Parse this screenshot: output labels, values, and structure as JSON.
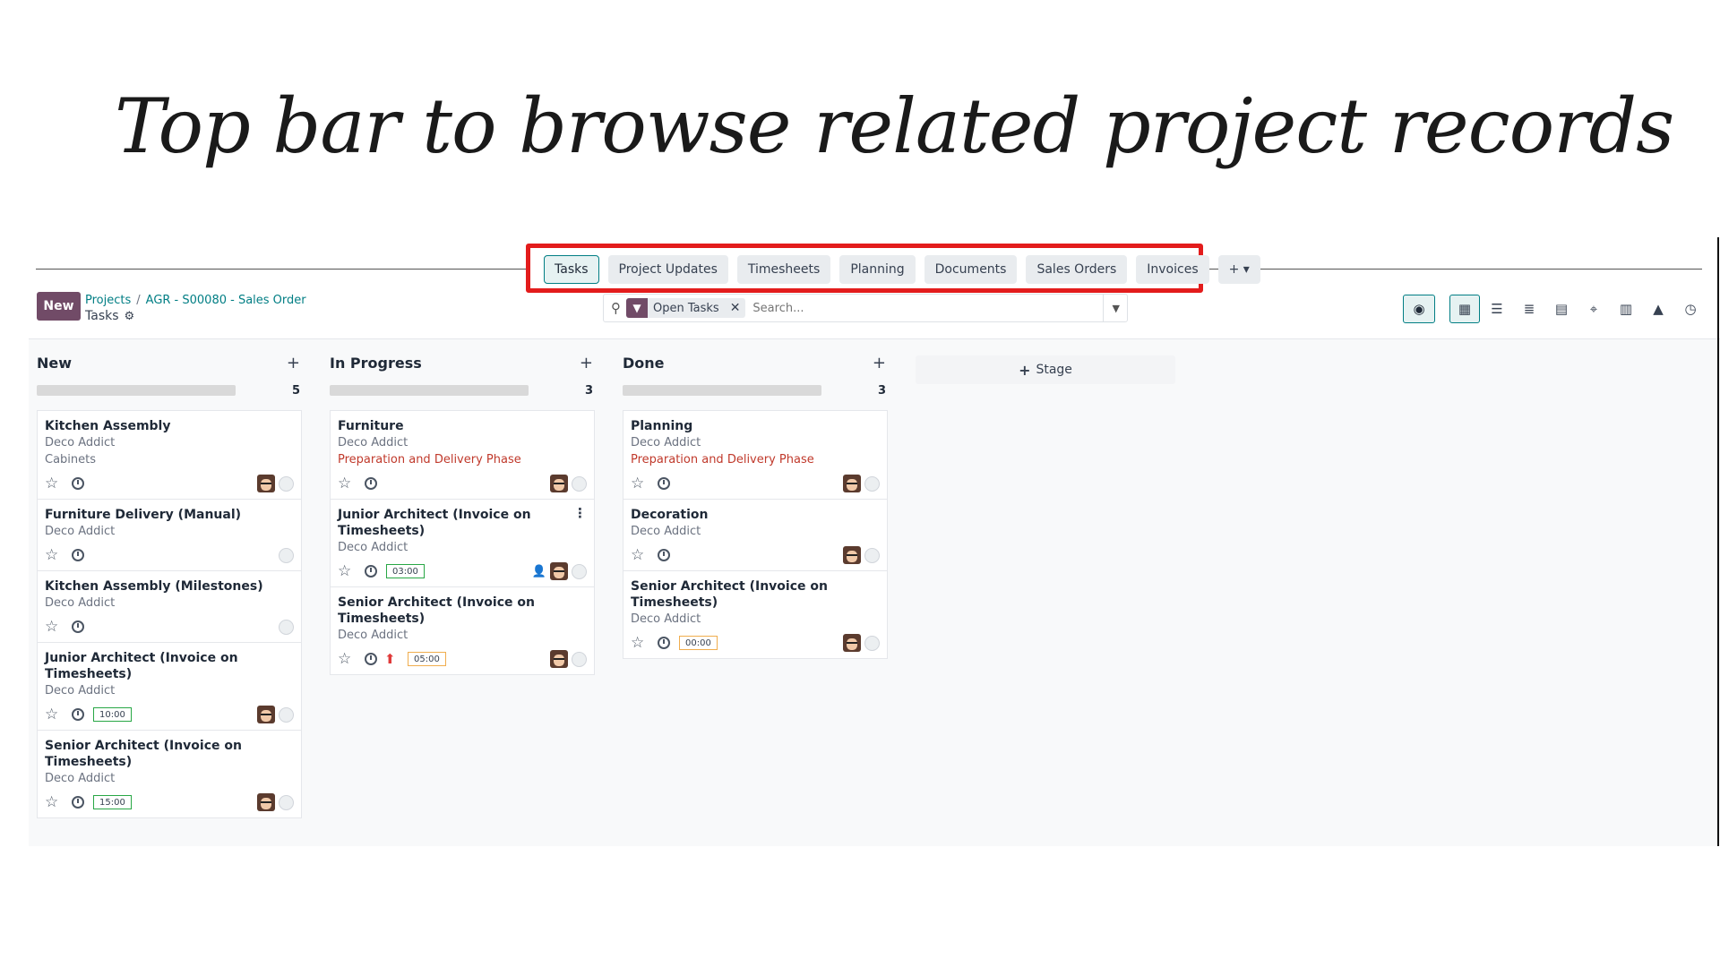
{
  "headline": "Top bar to browse related project records",
  "relations": {
    "tabs": [
      "Tasks",
      "Project Updates",
      "Timesheets",
      "Planning",
      "Documents",
      "Sales Orders",
      "Invoices"
    ],
    "more_label": "+ ▾"
  },
  "control_panel": {
    "new_label": "New",
    "breadcrumb": [
      "Projects",
      "AGR - S00080 - Sales Order"
    ],
    "breadcrumb_sep": "/",
    "subtitle": "Tasks",
    "search": {
      "facet": "Open Tasks",
      "placeholder": "Search..."
    }
  },
  "icons": {
    "search": "search-icon",
    "filter": "filter-icon",
    "eye": "eye-icon",
    "views": [
      "kanban-view-icon",
      "list-view-icon",
      "activity-list-view-icon",
      "calendar-view-icon",
      "map-view-icon",
      "pivot-view-icon",
      "graph-view-icon",
      "activity-view-icon"
    ]
  },
  "colors": {
    "brand": "#714b67",
    "accent": "#017e84",
    "highlight": "#e31c1c",
    "milestone": "#c0392b"
  },
  "columns": [
    {
      "title": "New",
      "count": "5",
      "cards": [
        {
          "title": "Kitchen Assembly",
          "customer": "Deco Addict",
          "tag": "Cabinets",
          "milestone": "",
          "hours": "",
          "avatar": true,
          "menu": false
        },
        {
          "title": "Furniture Delivery (Manual)",
          "customer": "Deco Addict",
          "tag": "",
          "milestone": "",
          "hours": "",
          "avatar": false,
          "menu": false
        },
        {
          "title": "Kitchen Assembly (Milestones)",
          "customer": "Deco Addict",
          "tag": "",
          "milestone": "",
          "hours": "",
          "avatar": false,
          "menu": false
        },
        {
          "title": "Junior Architect (Invoice on Timesheets)",
          "customer": "Deco Addict",
          "tag": "",
          "milestone": "",
          "hours": "10:00",
          "avatar": true,
          "menu": false
        },
        {
          "title": "Senior Architect (Invoice on Timesheets)",
          "customer": "Deco Addict",
          "tag": "",
          "milestone": "",
          "hours": "15:00",
          "avatar": true,
          "menu": false
        }
      ]
    },
    {
      "title": "In Progress",
      "count": "3",
      "cards": [
        {
          "title": "Furniture",
          "customer": "Deco Addict",
          "tag": "",
          "milestone": "Preparation and Delivery Phase",
          "hours": "",
          "avatar": true,
          "menu": false
        },
        {
          "title": "Junior Architect (Invoice on Timesheets)",
          "customer": "Deco Addict",
          "tag": "",
          "milestone": "",
          "hours": "03:00",
          "avatar": true,
          "menu": true,
          "follower": true
        },
        {
          "title": "Senior Architect (Invoice on Timesheets)",
          "customer": "Deco Addict",
          "tag": "",
          "milestone": "",
          "hours": "05:00",
          "hours_warn": true,
          "avatar": true,
          "menu": false,
          "upload": true
        }
      ]
    },
    {
      "title": "Done",
      "count": "3",
      "cards": [
        {
          "title": "Planning",
          "customer": "Deco Addict",
          "tag": "",
          "milestone": "Preparation and Delivery Phase",
          "hours": "",
          "avatar": true,
          "menu": false
        },
        {
          "title": "Decoration",
          "customer": "Deco Addict",
          "tag": "",
          "milestone": "",
          "hours": "",
          "avatar": true,
          "menu": false
        },
        {
          "title": "Senior Architect (Invoice on Timesheets)",
          "customer": "Deco Addict",
          "tag": "",
          "milestone": "",
          "hours": "00:00",
          "hours_warn": true,
          "avatar": true,
          "menu": false
        }
      ]
    }
  ],
  "stage_button": "Stage"
}
